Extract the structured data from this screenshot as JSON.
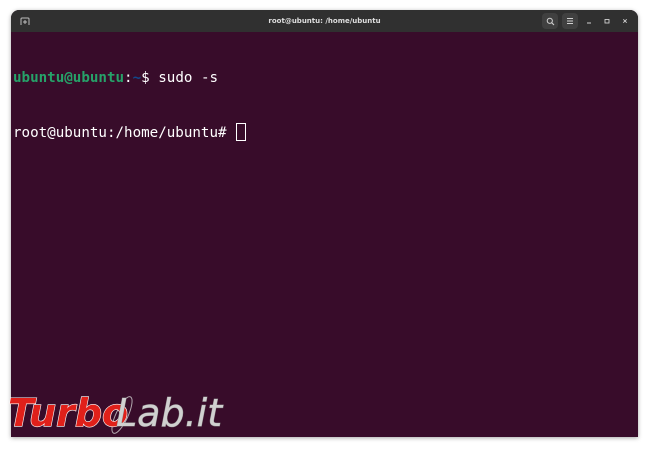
{
  "window": {
    "title": "root@ubuntu: /home/ubuntu",
    "icons": {
      "new_tab": "new-tab-icon",
      "search": "search-icon",
      "menu": "hamburger-menu-icon",
      "minimize": "minimize-icon",
      "maximize": "maximize-icon",
      "close": "close-icon"
    }
  },
  "terminal": {
    "line1": {
      "user_host": "ubuntu@ubuntu",
      "colon": ":",
      "path": "~",
      "prompt_symbol": "$ ",
      "command": "sudo -s"
    },
    "line2": {
      "prompt": "root@ubuntu:/home/ubuntu# "
    }
  },
  "watermark": {
    "text_part1": "Turbo",
    "text_part2": "Lab.it"
  },
  "colors": {
    "terminal_bg": "#380c2a",
    "titlebar_bg": "#303030",
    "user_green": "#26a269",
    "path_blue": "#12488b",
    "watermark_red": "#e0201a",
    "watermark_gray": "#d0d0d0"
  }
}
